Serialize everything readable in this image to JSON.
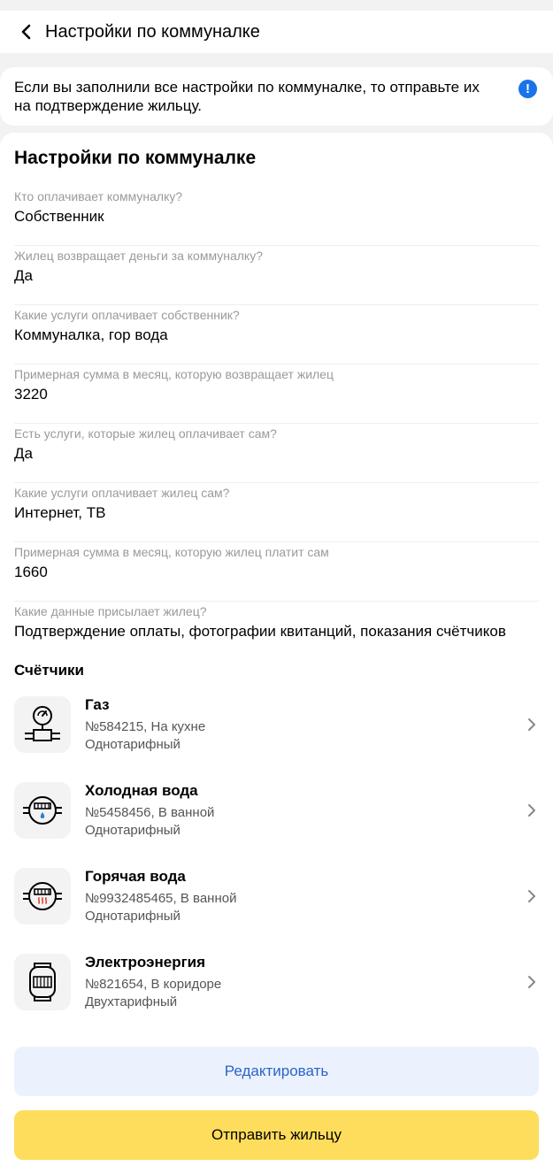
{
  "header": {
    "title": "Настройки по коммуналке"
  },
  "info": {
    "text": "Если вы заполнили все настройки по коммуналке, то отправьте их на подтверждение жильцу.",
    "icon": "exclamation-icon",
    "icon_color": "#1a73e8"
  },
  "main": {
    "title": "Настройки по коммуналке",
    "fields": [
      {
        "label": "Кто оплачивает коммуналку?",
        "value": "Собственник"
      },
      {
        "label": "Жилец возвращает деньги за коммуналку?",
        "value": "Да"
      },
      {
        "label": "Какие услуги оплачивает собственник?",
        "value": "Коммуналка, гор вода"
      },
      {
        "label": "Примерная сумма в месяц, которую возвращает жилец",
        "value": "3220"
      },
      {
        "label": "Есть услуги, которые жилец оплачивает сам?",
        "value": "Да"
      },
      {
        "label": "Какие услуги оплачивает жилец сам?",
        "value": "Интернет, ТВ"
      },
      {
        "label": "Примерная сумма в месяц, которую жилец платит сам",
        "value": "1660"
      },
      {
        "label": "Какие данные присылает жилец?",
        "value": "Подтверждение оплаты, фотографии квитанций, показания счётчиков"
      }
    ]
  },
  "meters": {
    "title": "Счётчики",
    "items": [
      {
        "icon": "gas-meter-icon",
        "name": "Газ",
        "line1": "№584215, На кухне",
        "line2": "Однотарифный"
      },
      {
        "icon": "cold-water-meter-icon",
        "name": "Холодная вода",
        "line1": "№5458456, В ванной",
        "line2": "Однотарифный"
      },
      {
        "icon": "hot-water-meter-icon",
        "name": "Горячая вода",
        "line1": "№9932485465, В ванной",
        "line2": "Однотарифный"
      },
      {
        "icon": "electricity-meter-icon",
        "name": "Электроэнергия",
        "line1": "№821654, В коридоре",
        "line2": "Двухтарифный"
      }
    ]
  },
  "buttons": {
    "edit_label": "Редактировать",
    "send_label": "Отправить жильцу",
    "edit_bg": "#ecf2fd",
    "send_bg": "#ffdd5c"
  }
}
